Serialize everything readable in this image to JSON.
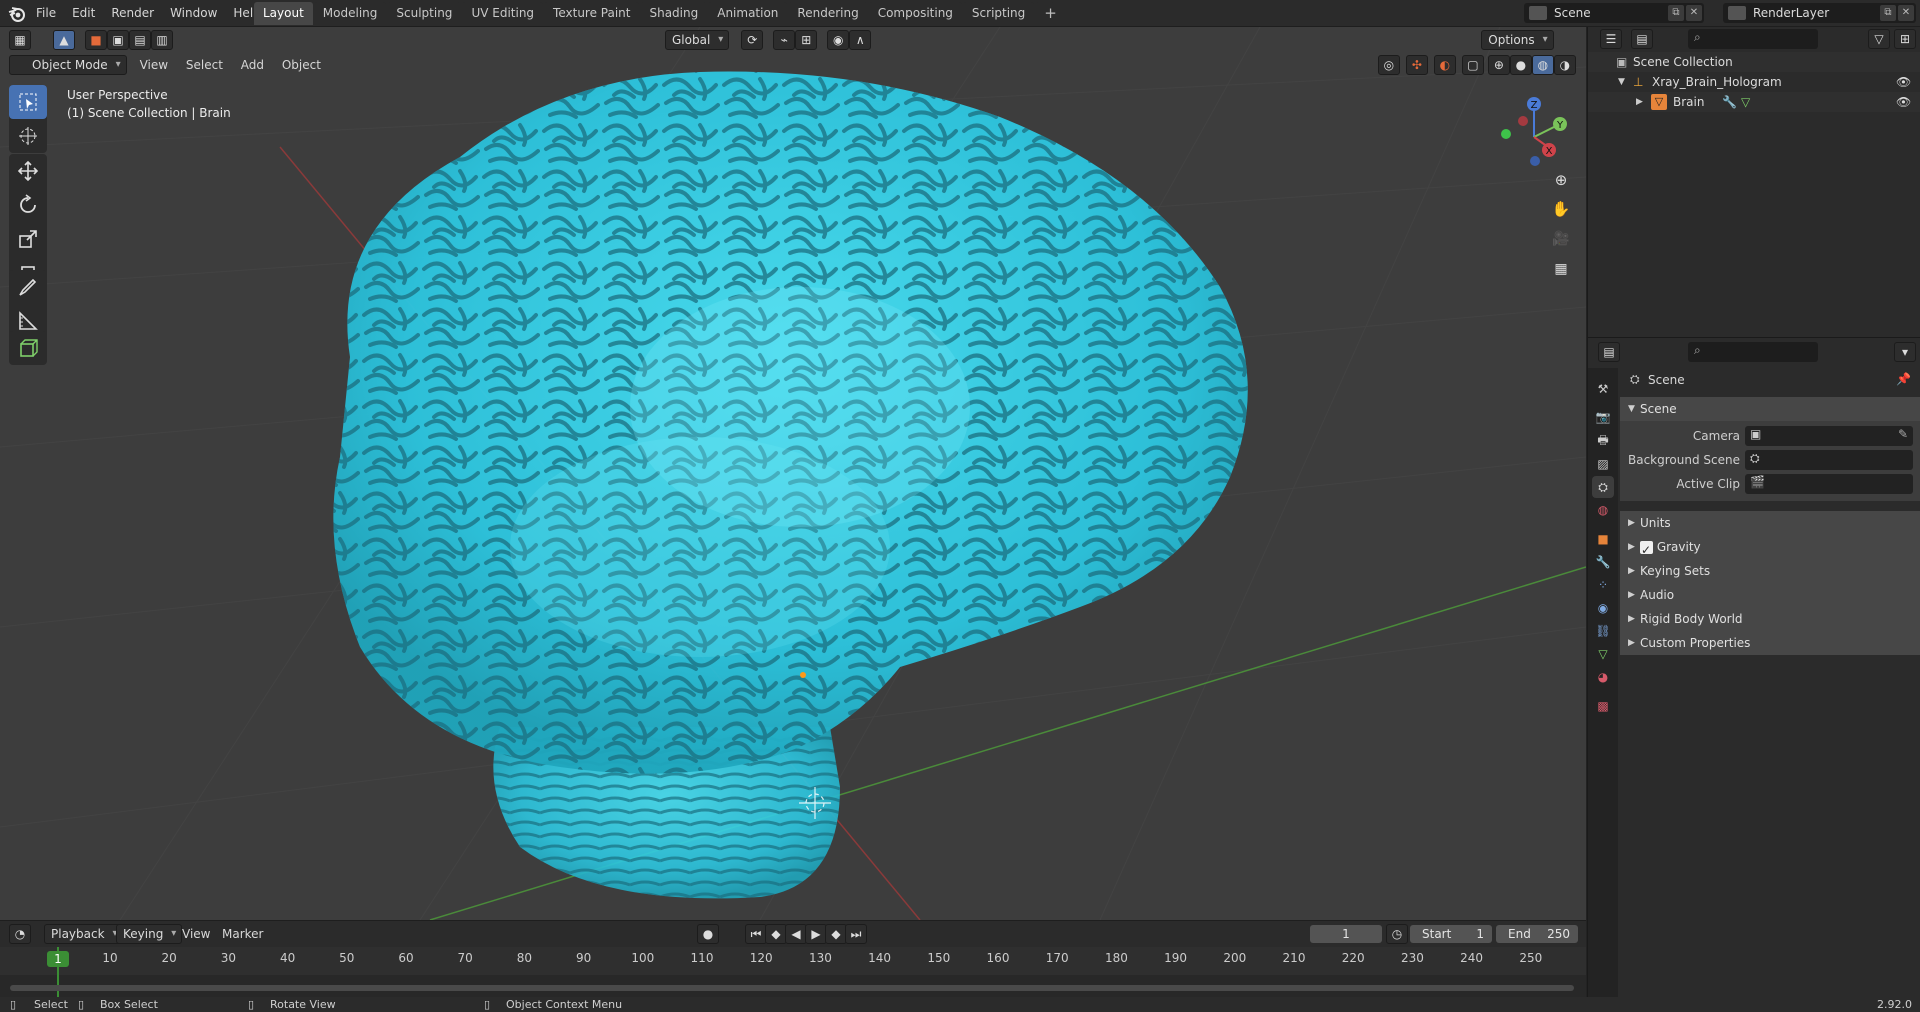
{
  "topbar": {
    "menu": [
      "File",
      "Edit",
      "Render",
      "Window",
      "Help"
    ],
    "tabs": [
      "Layout",
      "Modeling",
      "Sculpting",
      "UV Editing",
      "Texture Paint",
      "Shading",
      "Animation",
      "Rendering",
      "Compositing",
      "Scripting"
    ],
    "active_tab": "Layout",
    "scene_name": "Scene",
    "view_layer": "RenderLayer"
  },
  "viewport": {
    "mode": "Object Mode",
    "menu": [
      "View",
      "Select",
      "Add",
      "Object"
    ],
    "orientation": "Global",
    "options_label": "Options",
    "perspective_label": "User Perspective",
    "context_label": "(1) Scene Collection | Brain",
    "gizmo_axes": {
      "x": "X",
      "y": "Y",
      "z": "Z"
    },
    "object_color": "#34d6ee"
  },
  "timeline": {
    "menu": [
      "Playback",
      "Keying",
      "View",
      "Marker"
    ],
    "current_frame": "1",
    "start_label": "Start",
    "start": "1",
    "end_label": "End",
    "end": "250",
    "ticks": [
      "10",
      "20",
      "30",
      "40",
      "50",
      "60",
      "70",
      "80",
      "90",
      "100",
      "110",
      "120",
      "130",
      "140",
      "150",
      "160",
      "170",
      "180",
      "190",
      "200",
      "210",
      "220",
      "230",
      "240",
      "250"
    ],
    "playhead": "1"
  },
  "statusbar": {
    "select": "Select",
    "box_select": "Box Select",
    "rotate_view": "Rotate View",
    "context_menu": "Object Context Menu",
    "version": "2.92.0"
  },
  "outliner": {
    "root": "Scene Collection",
    "collection": "Xray_Brain_Hologram",
    "object": "Brain"
  },
  "properties": {
    "breadcrumb": "Scene",
    "scene_panel": "Scene",
    "camera_label": "Camera",
    "background_scene_label": "Background Scene",
    "active_clip_label": "Active Clip",
    "sections": [
      "Units",
      "Gravity",
      "Keying Sets",
      "Audio",
      "Rigid Body World",
      "Custom Properties"
    ]
  }
}
